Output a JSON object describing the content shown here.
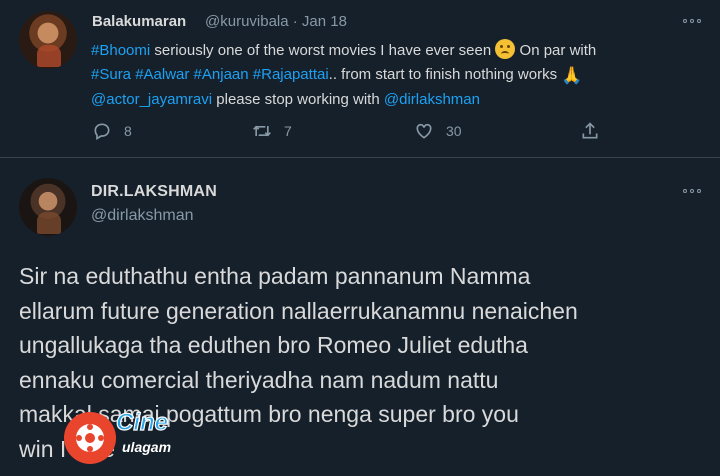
{
  "tweet1": {
    "display_name": "Balakumaran",
    "handle_time": "@kuruvibala · Jan 18",
    "line1_tag": "#Bhoomi",
    "line1_text": " seriously one of the worst movies I have ever seen ",
    "line1_tail": " On par with",
    "line2_tags": "#Sura #Aalwar #Anjaan #Rajapattai",
    "line2_text": ".. from start to finish nothing works ",
    "line3_mention1": "@actor_jayamravi",
    "line3_text": " please stop working with ",
    "line3_mention2": "@dirlakshman",
    "reply_count": "8",
    "retweet_count": "7",
    "like_count": "30",
    "icons": [
      "sad-face-emoji",
      "pray-emoji",
      "reply-icon",
      "retweet-icon",
      "like-icon",
      "share-icon",
      "more-icon"
    ]
  },
  "tweet2": {
    "display_name": "DIR.LAKSHMAN",
    "handle": "@dirlakshman",
    "text": "Sir na eduthathu entha padam pannanum Namma\nellarum future generation nallaerrukanamnu nenaichen\nungallukaga tha eduthen bro Romeo Juliet edutha\nennaku comercial theriyadha nam nadum nattu\nmakkal samai pogattum bro nenga super bro you\nwin I lose"
  },
  "watermark": {
    "line1": "Cine",
    "line2": "ulagam"
  },
  "colors": {
    "background": "#15202b",
    "text": "#d9d9d9",
    "muted": "#8899a6",
    "link": "#1da1f2",
    "divider": "#38444d"
  }
}
